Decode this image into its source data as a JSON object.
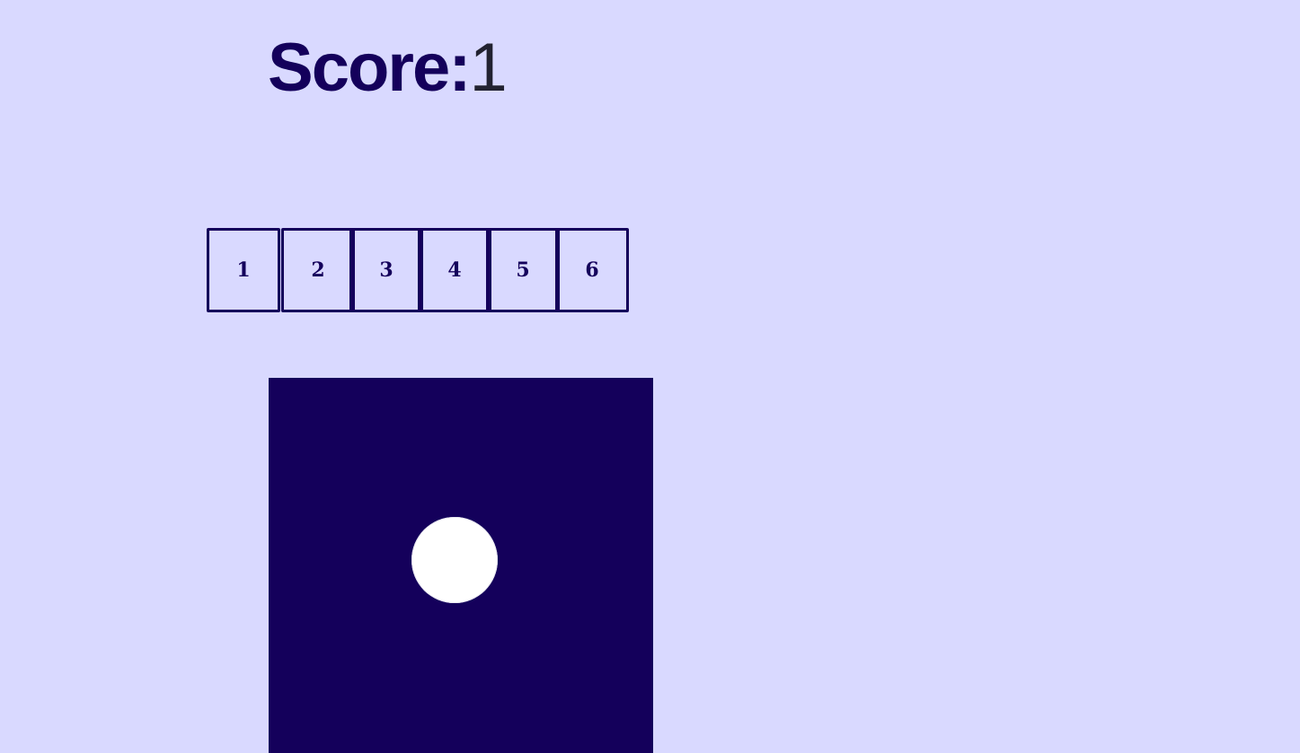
{
  "score": {
    "label": "Score:",
    "value": "1"
  },
  "choices": [
    {
      "label": "1"
    },
    {
      "label": "2"
    },
    {
      "label": "3"
    },
    {
      "label": "4"
    },
    {
      "label": "5"
    },
    {
      "label": "6"
    }
  ],
  "die": {
    "face_value": 1,
    "pip_color": "#ffffff",
    "face_color": "#14005b"
  },
  "colors": {
    "background": "#d9d9ff",
    "accent": "#14005b",
    "score_value": "#222230"
  }
}
